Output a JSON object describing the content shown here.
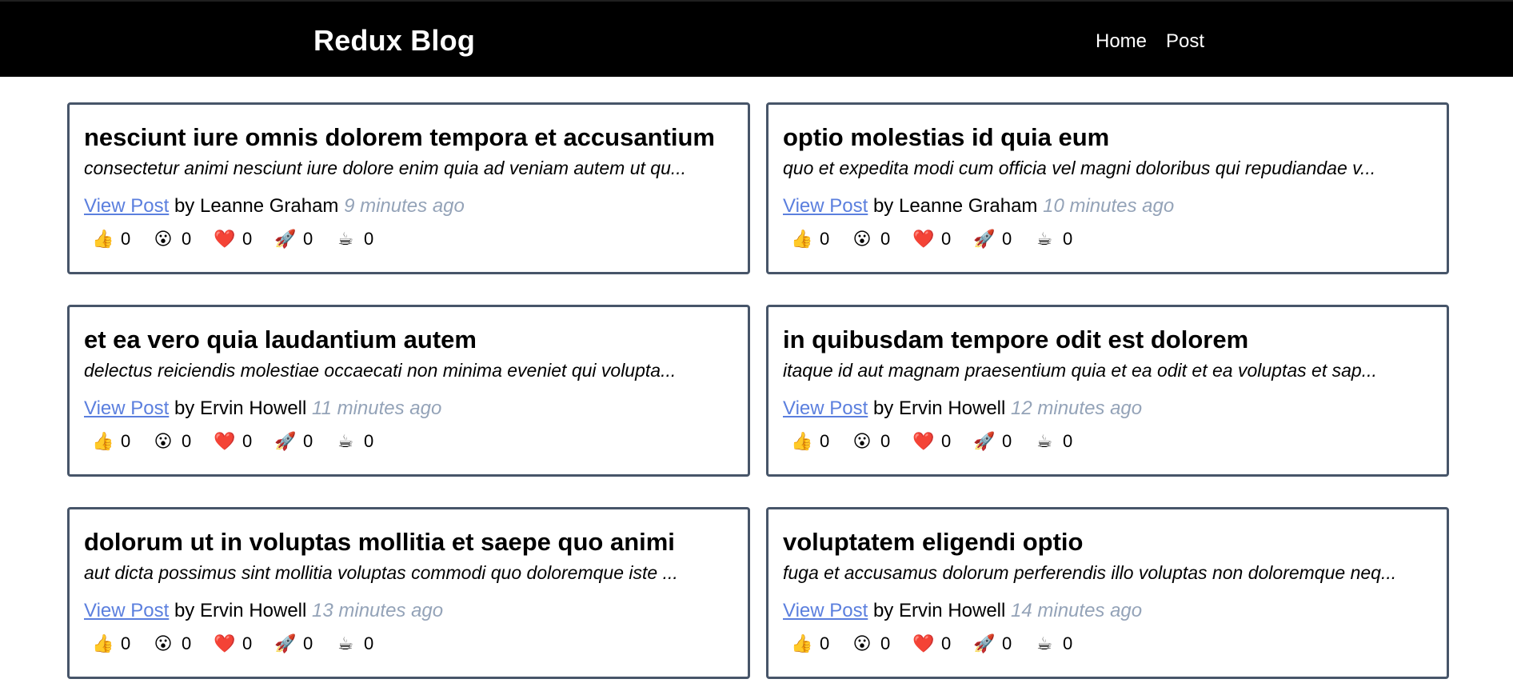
{
  "header": {
    "title": "Redux Blog",
    "nav": [
      {
        "label": "Home"
      },
      {
        "label": "Post"
      }
    ]
  },
  "reaction_icons": [
    "thumbs-up-icon",
    "wow-icon",
    "heart-icon",
    "rocket-icon",
    "coffee-icon"
  ],
  "posts": [
    {
      "title": "nesciunt iure omnis dolorem tempora et accusantium",
      "excerpt": "consectetur animi nesciunt iure dolore enim quia ad veniam autem ut qu...",
      "link": "View Post",
      "author": "by Leanne Graham",
      "time": "9 minutes ago",
      "reactions": [
        {
          "emoji": "👍",
          "count": "0"
        },
        {
          "emoji": "😮",
          "count": "0"
        },
        {
          "emoji": "❤️",
          "count": "0"
        },
        {
          "emoji": "🚀",
          "count": "0"
        },
        {
          "emoji": "☕",
          "count": "0"
        }
      ]
    },
    {
      "title": "optio molestias id quia eum",
      "excerpt": "quo et expedita modi cum officia vel magni doloribus qui repudiandae v...",
      "link": "View Post",
      "author": "by Leanne Graham",
      "time": "10 minutes ago",
      "reactions": [
        {
          "emoji": "👍",
          "count": "0"
        },
        {
          "emoji": "😮",
          "count": "0"
        },
        {
          "emoji": "❤️",
          "count": "0"
        },
        {
          "emoji": "🚀",
          "count": "0"
        },
        {
          "emoji": "☕",
          "count": "0"
        }
      ]
    },
    {
      "title": "et ea vero quia laudantium autem",
      "excerpt": "delectus reiciendis molestiae occaecati non minima eveniet qui volupta...",
      "link": "View Post",
      "author": "by Ervin Howell",
      "time": "11 minutes ago",
      "reactions": [
        {
          "emoji": "👍",
          "count": "0"
        },
        {
          "emoji": "😮",
          "count": "0"
        },
        {
          "emoji": "❤️",
          "count": "0"
        },
        {
          "emoji": "🚀",
          "count": "0"
        },
        {
          "emoji": "☕",
          "count": "0"
        }
      ]
    },
    {
      "title": "in quibusdam tempore odit est dolorem",
      "excerpt": "itaque id aut magnam praesentium quia et ea odit et ea voluptas et sap...",
      "link": "View Post",
      "author": "by Ervin Howell",
      "time": "12 minutes ago",
      "reactions": [
        {
          "emoji": "👍",
          "count": "0"
        },
        {
          "emoji": "😮",
          "count": "0"
        },
        {
          "emoji": "❤️",
          "count": "0"
        },
        {
          "emoji": "🚀",
          "count": "0"
        },
        {
          "emoji": "☕",
          "count": "0"
        }
      ]
    },
    {
      "title": "dolorum ut in voluptas mollitia et saepe quo animi",
      "excerpt": "aut dicta possimus sint mollitia voluptas commodi quo doloremque iste ...",
      "link": "View Post",
      "author": "by Ervin Howell",
      "time": "13 minutes ago",
      "reactions": [
        {
          "emoji": "👍",
          "count": "0"
        },
        {
          "emoji": "😮",
          "count": "0"
        },
        {
          "emoji": "❤️",
          "count": "0"
        },
        {
          "emoji": "🚀",
          "count": "0"
        },
        {
          "emoji": "☕",
          "count": "0"
        }
      ]
    },
    {
      "title": "voluptatem eligendi optio",
      "excerpt": "fuga et accusamus dolorum perferendis illo voluptas non doloremque neq...",
      "link": "View Post",
      "author": "by Ervin Howell",
      "time": "14 minutes ago",
      "reactions": [
        {
          "emoji": "👍",
          "count": "0"
        },
        {
          "emoji": "😮",
          "count": "0"
        },
        {
          "emoji": "❤️",
          "count": "0"
        },
        {
          "emoji": "🚀",
          "count": "0"
        },
        {
          "emoji": "☕",
          "count": "0"
        }
      ]
    }
  ]
}
